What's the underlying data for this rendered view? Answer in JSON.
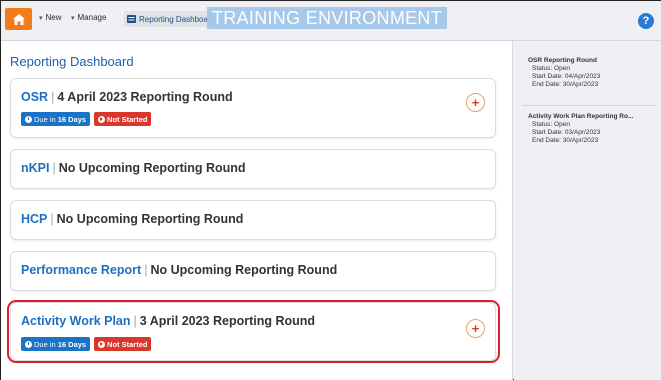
{
  "topbar": {
    "new_label": "New",
    "manage_label": "Manage",
    "dashboard_label": "Reporting Dashboard",
    "environment_banner": "TRAINING ENVIRONMENT",
    "help_label": "?"
  },
  "main": {
    "title": "Reporting Dashboard",
    "cards": [
      {
        "program": "OSR",
        "round": "4 April 2023 Reporting Round",
        "due_text": "Due in",
        "due_days": "16 Days",
        "status": "Not Started"
      },
      {
        "program": "nKPI",
        "round": "No Upcoming Reporting Round"
      },
      {
        "program": "HCP",
        "round": "No Upcoming Reporting Round"
      },
      {
        "program": "Performance Report",
        "round": "No Upcoming Reporting Round"
      },
      {
        "program": "Activity Work Plan",
        "round": "3 April 2023 Reporting Round",
        "due_text": "Due in",
        "due_days": "16 Days",
        "status": "Not Started"
      }
    ]
  },
  "sidebar": {
    "rounds": [
      {
        "title": "OSR Reporting Round",
        "status": "Status: Open",
        "start": "Start Date: 04/Apr/2023",
        "end": "End Date: 30/Apr/2023"
      },
      {
        "title": "Activity Work Plan Reporting Ro...",
        "status": "Status: Open",
        "start": "Start Date: 03/Apr/2023",
        "end": "End Date: 30/Apr/2023"
      }
    ]
  },
  "colors": {
    "accent": "#1f6fc0",
    "home": "#f07d1a",
    "not_started": "#d9372b",
    "due": "#1a73c7",
    "highlight": "#d8202b"
  }
}
